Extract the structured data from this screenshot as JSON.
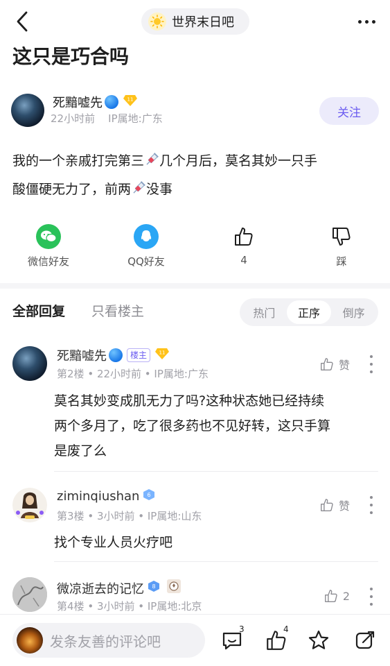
{
  "header": {
    "forum_name": "世界末日吧",
    "back_icon": "chevron-left-icon",
    "more_icon": "more-horizontal-icon"
  },
  "post": {
    "title": "这只是巧合吗",
    "author": {
      "name": "死黯嘘先",
      "level": "11",
      "time": "22小时前",
      "ip": "IP属地:广东",
      "follow_label": "关注"
    },
    "body_line1_a": "我的一个亲戚打完第三",
    "body_line1_b": "几个月后，莫名其妙一只手",
    "body_line2_a": "酸僵硬无力了，前两",
    "body_line2_b": "没事"
  },
  "actions": {
    "wechat": "微信好友",
    "qq": "QQ好友",
    "like_count": "4",
    "dislike": "踩"
  },
  "tabs": {
    "all": "全部回复",
    "host_only": "只看楼主",
    "sort_options": [
      "热门",
      "正序",
      "倒序"
    ],
    "sort_selected": "正序"
  },
  "comments": [
    {
      "name": "死黯嘘先",
      "host_tag": "楼主",
      "level": "11",
      "floor": "第2楼",
      "time": "22小时前",
      "ip": "IP属地:广东",
      "like_label": "赞",
      "lines": [
        "莫名其妙变成肌无力了吗?这种状态她已经持续",
        "两个多月了，吃了很多药也不见好转，这只手算",
        "是废了么"
      ]
    },
    {
      "name": "ziminqiushan",
      "level": "6",
      "floor": "第3楼",
      "time": "3小时前",
      "ip": "IP属地:山东",
      "like_label": "赞",
      "lines": [
        "找个专业人员火疗吧"
      ]
    },
    {
      "name": "微凉逝去的记忆",
      "level": "8",
      "floor": "第4楼",
      "time": "3小时前",
      "ip": "IP属地:北京",
      "like_label": "2",
      "lines": []
    }
  ],
  "bottom": {
    "placeholder": "发条友善的评论吧",
    "comment_count": "3",
    "like_count": "4"
  },
  "colors": {
    "accent": "#6b5cf0",
    "wechat": "#2ac25a",
    "qq": "#2aa6f5",
    "meta_gray": "#a1a1a8"
  }
}
